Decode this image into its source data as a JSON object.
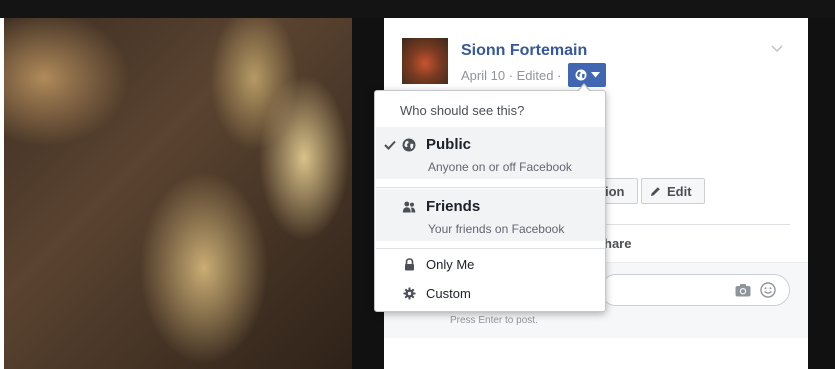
{
  "post": {
    "author": "Sionn Fortemain",
    "meta": "April 10 · Edited ·",
    "tag_button_label": "ion",
    "edit_button_label": "Edit",
    "share_label": "hare",
    "comment_hint": "Press Enter to post."
  },
  "audience_menu": {
    "heading": "Who should see this?",
    "options": [
      {
        "label": "Public",
        "description": "Anyone on or off Facebook",
        "icon": "globe-icon",
        "selected": true
      },
      {
        "label": "Friends",
        "description": "Your friends on Facebook",
        "icon": "friends-icon",
        "selected": false
      },
      {
        "label": "Only Me",
        "icon": "lock-icon",
        "selected": false
      },
      {
        "label": "Custom",
        "icon": "gear-icon",
        "selected": false
      }
    ]
  },
  "colors": {
    "accent": "#4267b2",
    "author_link": "#365899",
    "hover_row": "#f2f3f5"
  }
}
